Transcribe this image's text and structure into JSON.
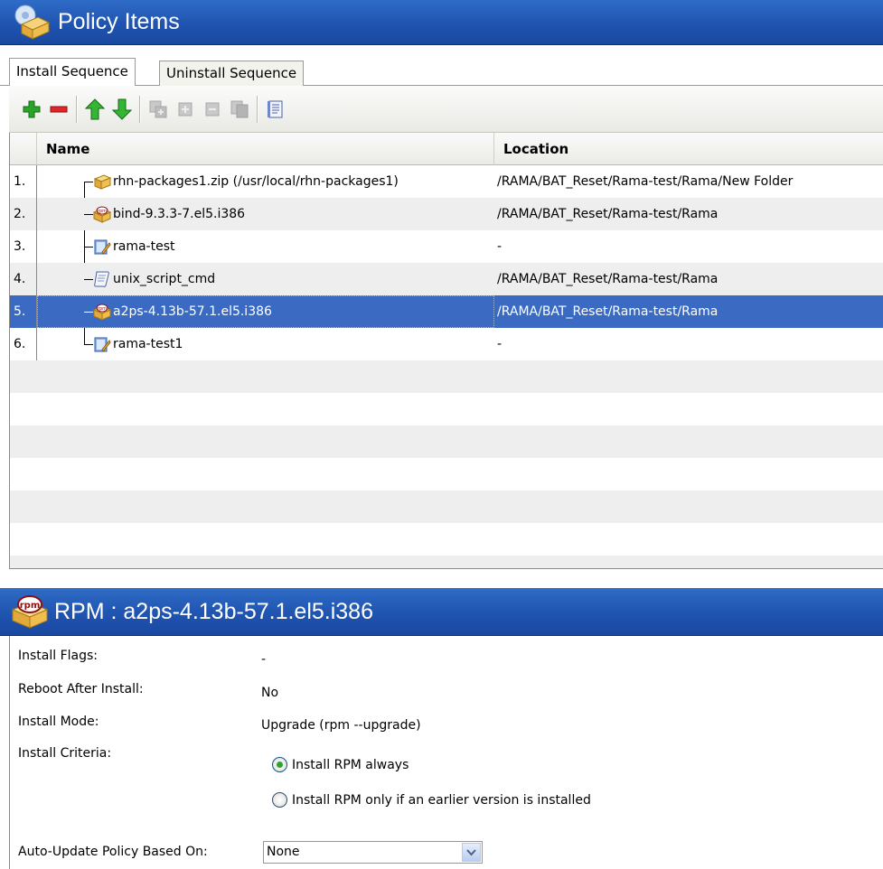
{
  "header": {
    "title": "Policy Items",
    "icon": "policy-items-icon"
  },
  "tabs": [
    {
      "label": "Install Sequence",
      "active": true
    },
    {
      "label": "Uninstall Sequence",
      "active": false
    }
  ],
  "toolbar": {
    "buttons": [
      "add-icon",
      "remove-icon",
      "move-up-icon",
      "move-down-icon",
      "copy-icon",
      "expand-icon",
      "collapse-icon",
      "paste-icon",
      "properties-icon"
    ]
  },
  "grid": {
    "columns": {
      "name": "Name",
      "location": "Location"
    },
    "rows": [
      {
        "num": "1.",
        "name": "rhn-packages1.zip (/usr/local/rhn-packages1)",
        "location": "/RAMA/BAT_Reset/Rama-test/Rama/New Folder",
        "icon": "zip-package-icon"
      },
      {
        "num": "2.",
        "name": "bind-9.3.3-7.el5.i386",
        "location": "/RAMA/BAT_Reset/Rama-test/Rama",
        "icon": "rpm-icon"
      },
      {
        "num": "3.",
        "name": "rama-test",
        "location": "-",
        "icon": "policy-icon"
      },
      {
        "num": "4.",
        "name": "unix_script_cmd",
        "location": "/RAMA/BAT_Reset/Rama-test/Rama",
        "icon": "script-icon"
      },
      {
        "num": "5.",
        "name": "a2ps-4.13b-57.1.el5.i386",
        "location": "/RAMA/BAT_Reset/Rama-test/Rama",
        "icon": "rpm-icon",
        "selected": true
      },
      {
        "num": "6.",
        "name": "rama-test1",
        "location": "-",
        "icon": "policy-icon"
      }
    ]
  },
  "detail": {
    "title": "RPM : a2ps-4.13b-57.1.el5.i386",
    "install_flags_label": "Install Flags:",
    "install_flags_value": "-",
    "reboot_label": "Reboot After Install:",
    "reboot_value": "No",
    "install_mode_label": "Install Mode:",
    "install_mode_value": "Upgrade (rpm --upgrade)",
    "install_criteria_label": "Install Criteria:",
    "criteria_option_always": "Install RPM always",
    "criteria_option_earlier": "Install RPM only if an earlier version is installed",
    "auto_update_label": "Auto-Update Policy Based On:",
    "auto_update_value": "None"
  },
  "colors": {
    "header_blue": "#1f54b0",
    "selection_blue": "#3a6ac2",
    "alt_row": "#eeeeee"
  }
}
